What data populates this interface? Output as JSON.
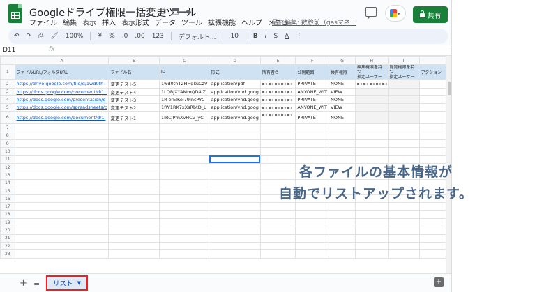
{
  "title": "Googleドライブ権限一括変更ツール",
  "title_icons": [
    "star-icon",
    "move-folder-icon",
    "cloud-status-icon"
  ],
  "menu": [
    "ファイル",
    "編集",
    "表示",
    "挿入",
    "表示形式",
    "データ",
    "ツール",
    "拡張機能",
    "ヘルプ",
    "メニュー"
  ],
  "last_edit": "最終編集: 数秒前（gasマネー",
  "share_label": "共有",
  "toolbar": {
    "undo": "↶",
    "redo": "↷",
    "print": "⎙",
    "paint": "🖌",
    "zoom": "100%",
    "currency": "¥",
    "percent": "%",
    "dec_less": ".0",
    "dec_more": ".00",
    "number_format": "123",
    "font": "デフォルト...",
    "font_size": "10",
    "bold": "B",
    "italic": "I",
    "strike": "S",
    "text_color": "A",
    "more": "⋮"
  },
  "namebox": "D11",
  "fx": "fx",
  "columns": [
    "A",
    "B",
    "C",
    "D",
    "E",
    "F",
    "G",
    "H",
    "I",
    ""
  ],
  "header_row": [
    "ファイルURL/フォルダURL",
    "ファイル名",
    "ID",
    "形式",
    "所有者名",
    "公開範囲",
    "共有権限",
    "編集権限を持つ\n指定ユーザー",
    "閲覧権限を持つ\n指定ユーザー",
    "アクション"
  ],
  "rows": [
    [
      "https://drive.google.com/file/d/1wd0thT",
      "変更テスト5",
      "1wd0thT2HHgkuCzV",
      "application/pdf",
      "",
      "PRIVATE",
      "NONE"
    ],
    [
      "https://docs.google.com/document/d/1L",
      "変更テスト4",
      "1LQBjXYAMmQD4lZ",
      "application/vnd.goog",
      "",
      "ANYONE_WIT",
      "VIEW"
    ],
    [
      "https://docs.google.com/presentation/d",
      "変更テスト3",
      "1R-efEIKel79lncPYC",
      "application/vnd.goog",
      "",
      "PRIVATE",
      "NONE"
    ],
    [
      "https://docs.google.com/spreadsheets/c",
      "変更テスト2",
      "1fW1RK7xXsRbtD_L",
      "application/vnd.goog",
      "",
      "ANYONE_WIT",
      "VIEW"
    ],
    [
      "https://docs.google.com/document/d/1I",
      "変更テスト1",
      "1IRCJPmXvHCV_yC",
      "application/vnd.goog",
      "",
      "PRIVATE",
      "NONE"
    ]
  ],
  "row_numbers": [
    "1",
    "2",
    "3",
    "4",
    "5",
    "6",
    "7",
    "8",
    "9",
    "10",
    "11",
    "12",
    "13",
    "14",
    "15",
    "16",
    "17",
    "18",
    "19",
    "20",
    "21",
    "22",
    "23"
  ],
  "sheet_tab": "リスト",
  "annotation": {
    "line1": "各ファイルの基本情報が",
    "line2": "自動でリストアップされます。"
  },
  "colors": {
    "brand_green": "#188038",
    "header_fill": "#cfe2f3",
    "link": "#1155cc",
    "annotation": "#4a6789",
    "highlight": "#ff1a1a"
  }
}
